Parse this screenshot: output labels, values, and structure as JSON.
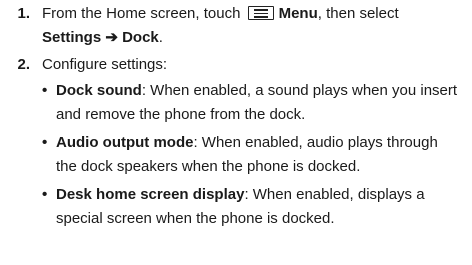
{
  "steps": [
    {
      "number": "1.",
      "text_before_icon": "From the Home screen, touch",
      "icon": "menu-icon",
      "menu_label": "Menu",
      "then_text": ", then select",
      "path_label": "Settings ➔ Dock",
      "end": "."
    },
    {
      "number": "2.",
      "text": "Configure settings:",
      "bullets": [
        {
          "term": "Dock sound",
          "desc": ": When enabled, a sound plays when you insert and remove the phone from the dock."
        },
        {
          "term": "Audio output mode",
          "desc": ": When enabled, audio plays through the dock speakers when the phone is docked."
        },
        {
          "term": "Desk home screen display",
          "desc": ": When enabled, displays a special screen when the phone is docked."
        }
      ]
    }
  ]
}
